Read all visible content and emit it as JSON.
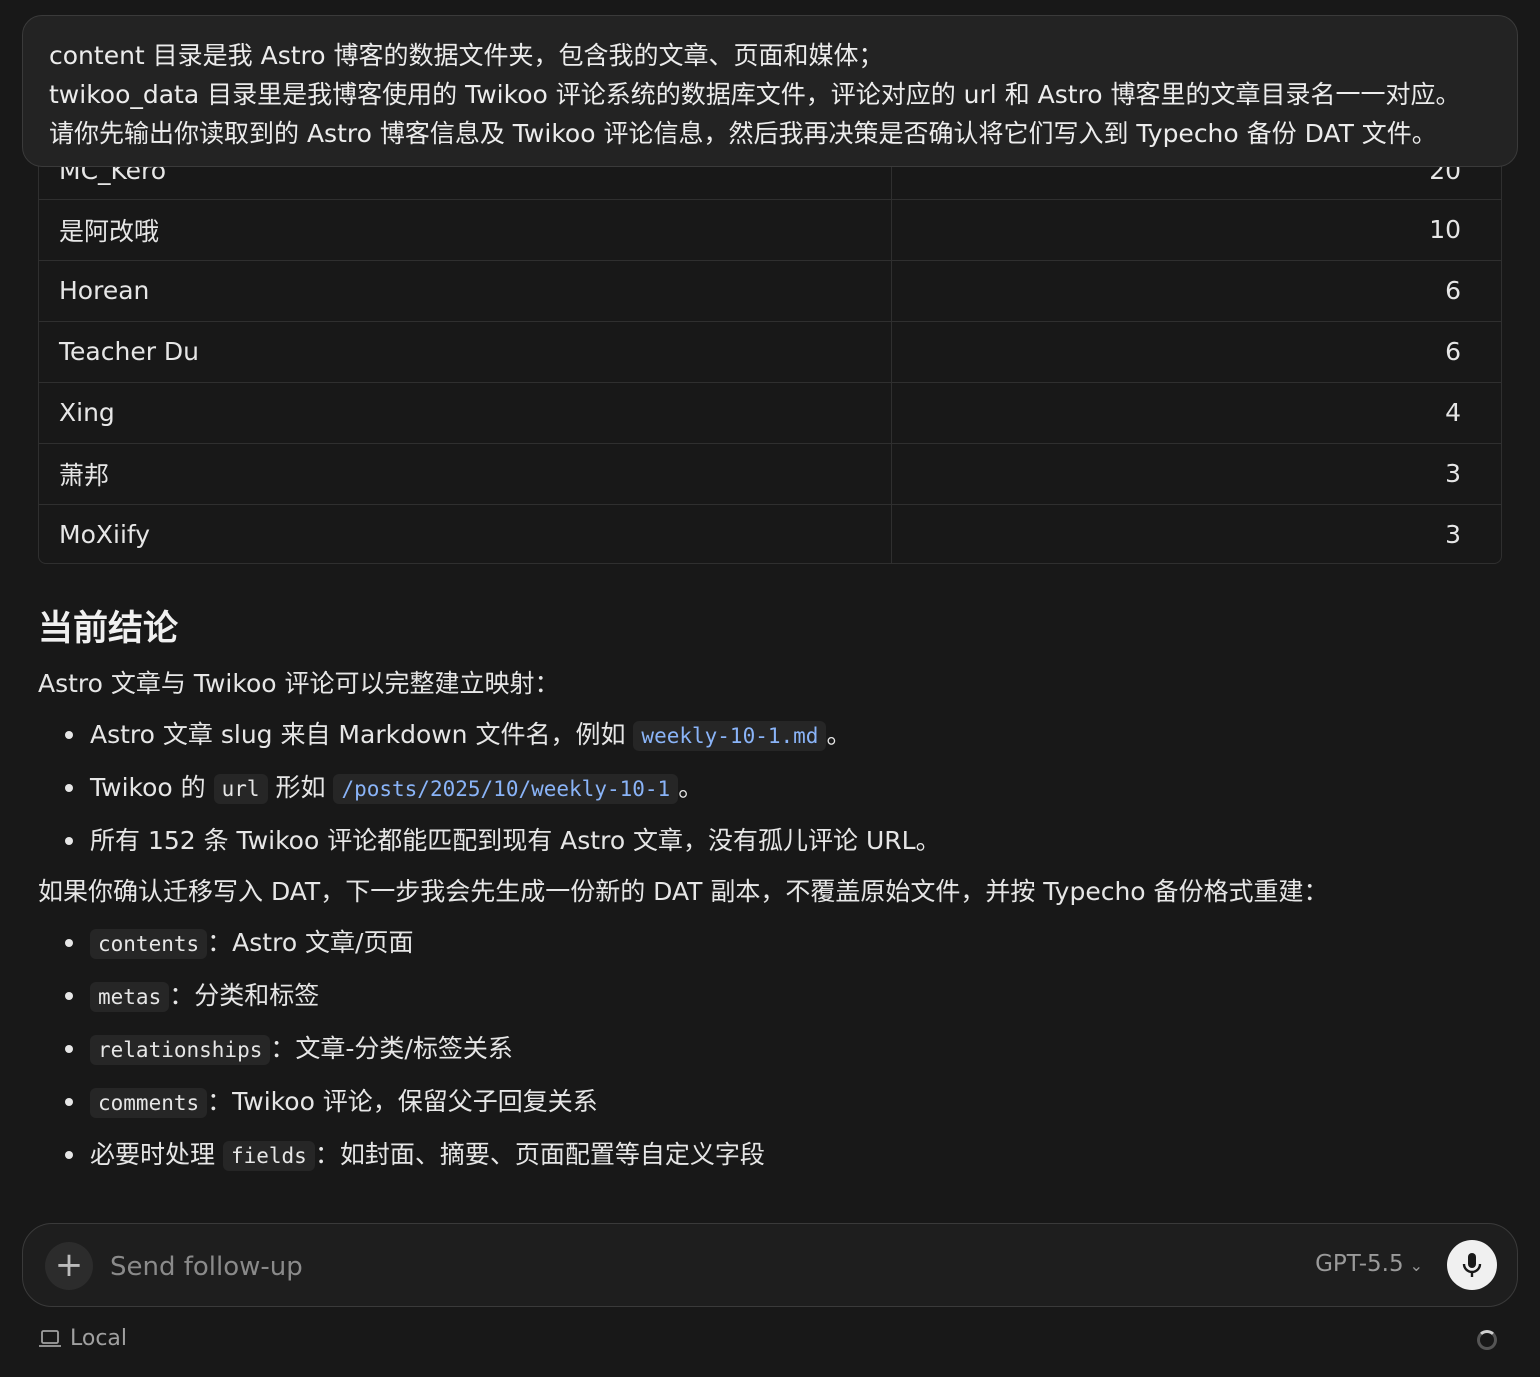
{
  "prompt": {
    "lines": [
      "content 目录是我 Astro 博客的数据文件夹，包含我的文章、页面和媒体；",
      "twikoo_data 目录里是我博客使用的 Twikoo 评论系统的数据库文件，评论对应的 url 和 Astro 博客里的文章目录名一一对应。",
      "请你先输出你读取到的 Astro 博客信息及 Twikoo 评论信息，然后我再决策是否确认将它们写入到 Typecho 备份 DAT 文件。"
    ]
  },
  "table": {
    "rows": [
      {
        "name": "MC_Kero",
        "count": "20"
      },
      {
        "name": "是阿改哦",
        "count": "10"
      },
      {
        "name": "Horean",
        "count": "6"
      },
      {
        "name": "Teacher Du",
        "count": "6"
      },
      {
        "name": "Xing",
        "count": "4"
      },
      {
        "name": "萧邦",
        "count": "3"
      },
      {
        "name": "MoXiify",
        "count": "3"
      }
    ]
  },
  "conclusion": {
    "heading": "当前结论",
    "intro": "Astro 文章与 Twikoo 评论可以完整建立映射：",
    "b1": {
      "pre": "Astro 文章 slug 来自 Markdown 文件名，例如 ",
      "code": "weekly-10-1.md",
      "post": "。"
    },
    "b2": {
      "pre": "Twikoo 的 ",
      "code1": "url",
      "mid": " 形如 ",
      "code2": "/posts/2025/10/weekly-10-1",
      "post": "。"
    },
    "b3": "所有 152 条 Twikoo 评论都能匹配到现有 Astro 文章，没有孤儿评论 URL。",
    "next": "如果你确认迁移写入 DAT，下一步我会先生成一份新的 DAT 副本，不覆盖原始文件，并按 Typecho 备份格式重建：",
    "items": [
      {
        "pre": "",
        "code": "contents",
        "post": "：Astro 文章/页面"
      },
      {
        "pre": "",
        "code": "metas",
        "post": "：分类和标签"
      },
      {
        "pre": "",
        "code": "relationships",
        "post": "：文章-分类/标签关系"
      },
      {
        "pre": "",
        "code": "comments",
        "post": "：Twikoo 评论，保留父子回复关系"
      },
      {
        "pre": "必要时处理 ",
        "code": "fields",
        "post": "：如封面、摘要、页面配置等自定义字段"
      }
    ]
  },
  "composer": {
    "placeholder": "Send follow-up",
    "model": "GPT-5.5"
  },
  "footer": {
    "location": "Local"
  }
}
